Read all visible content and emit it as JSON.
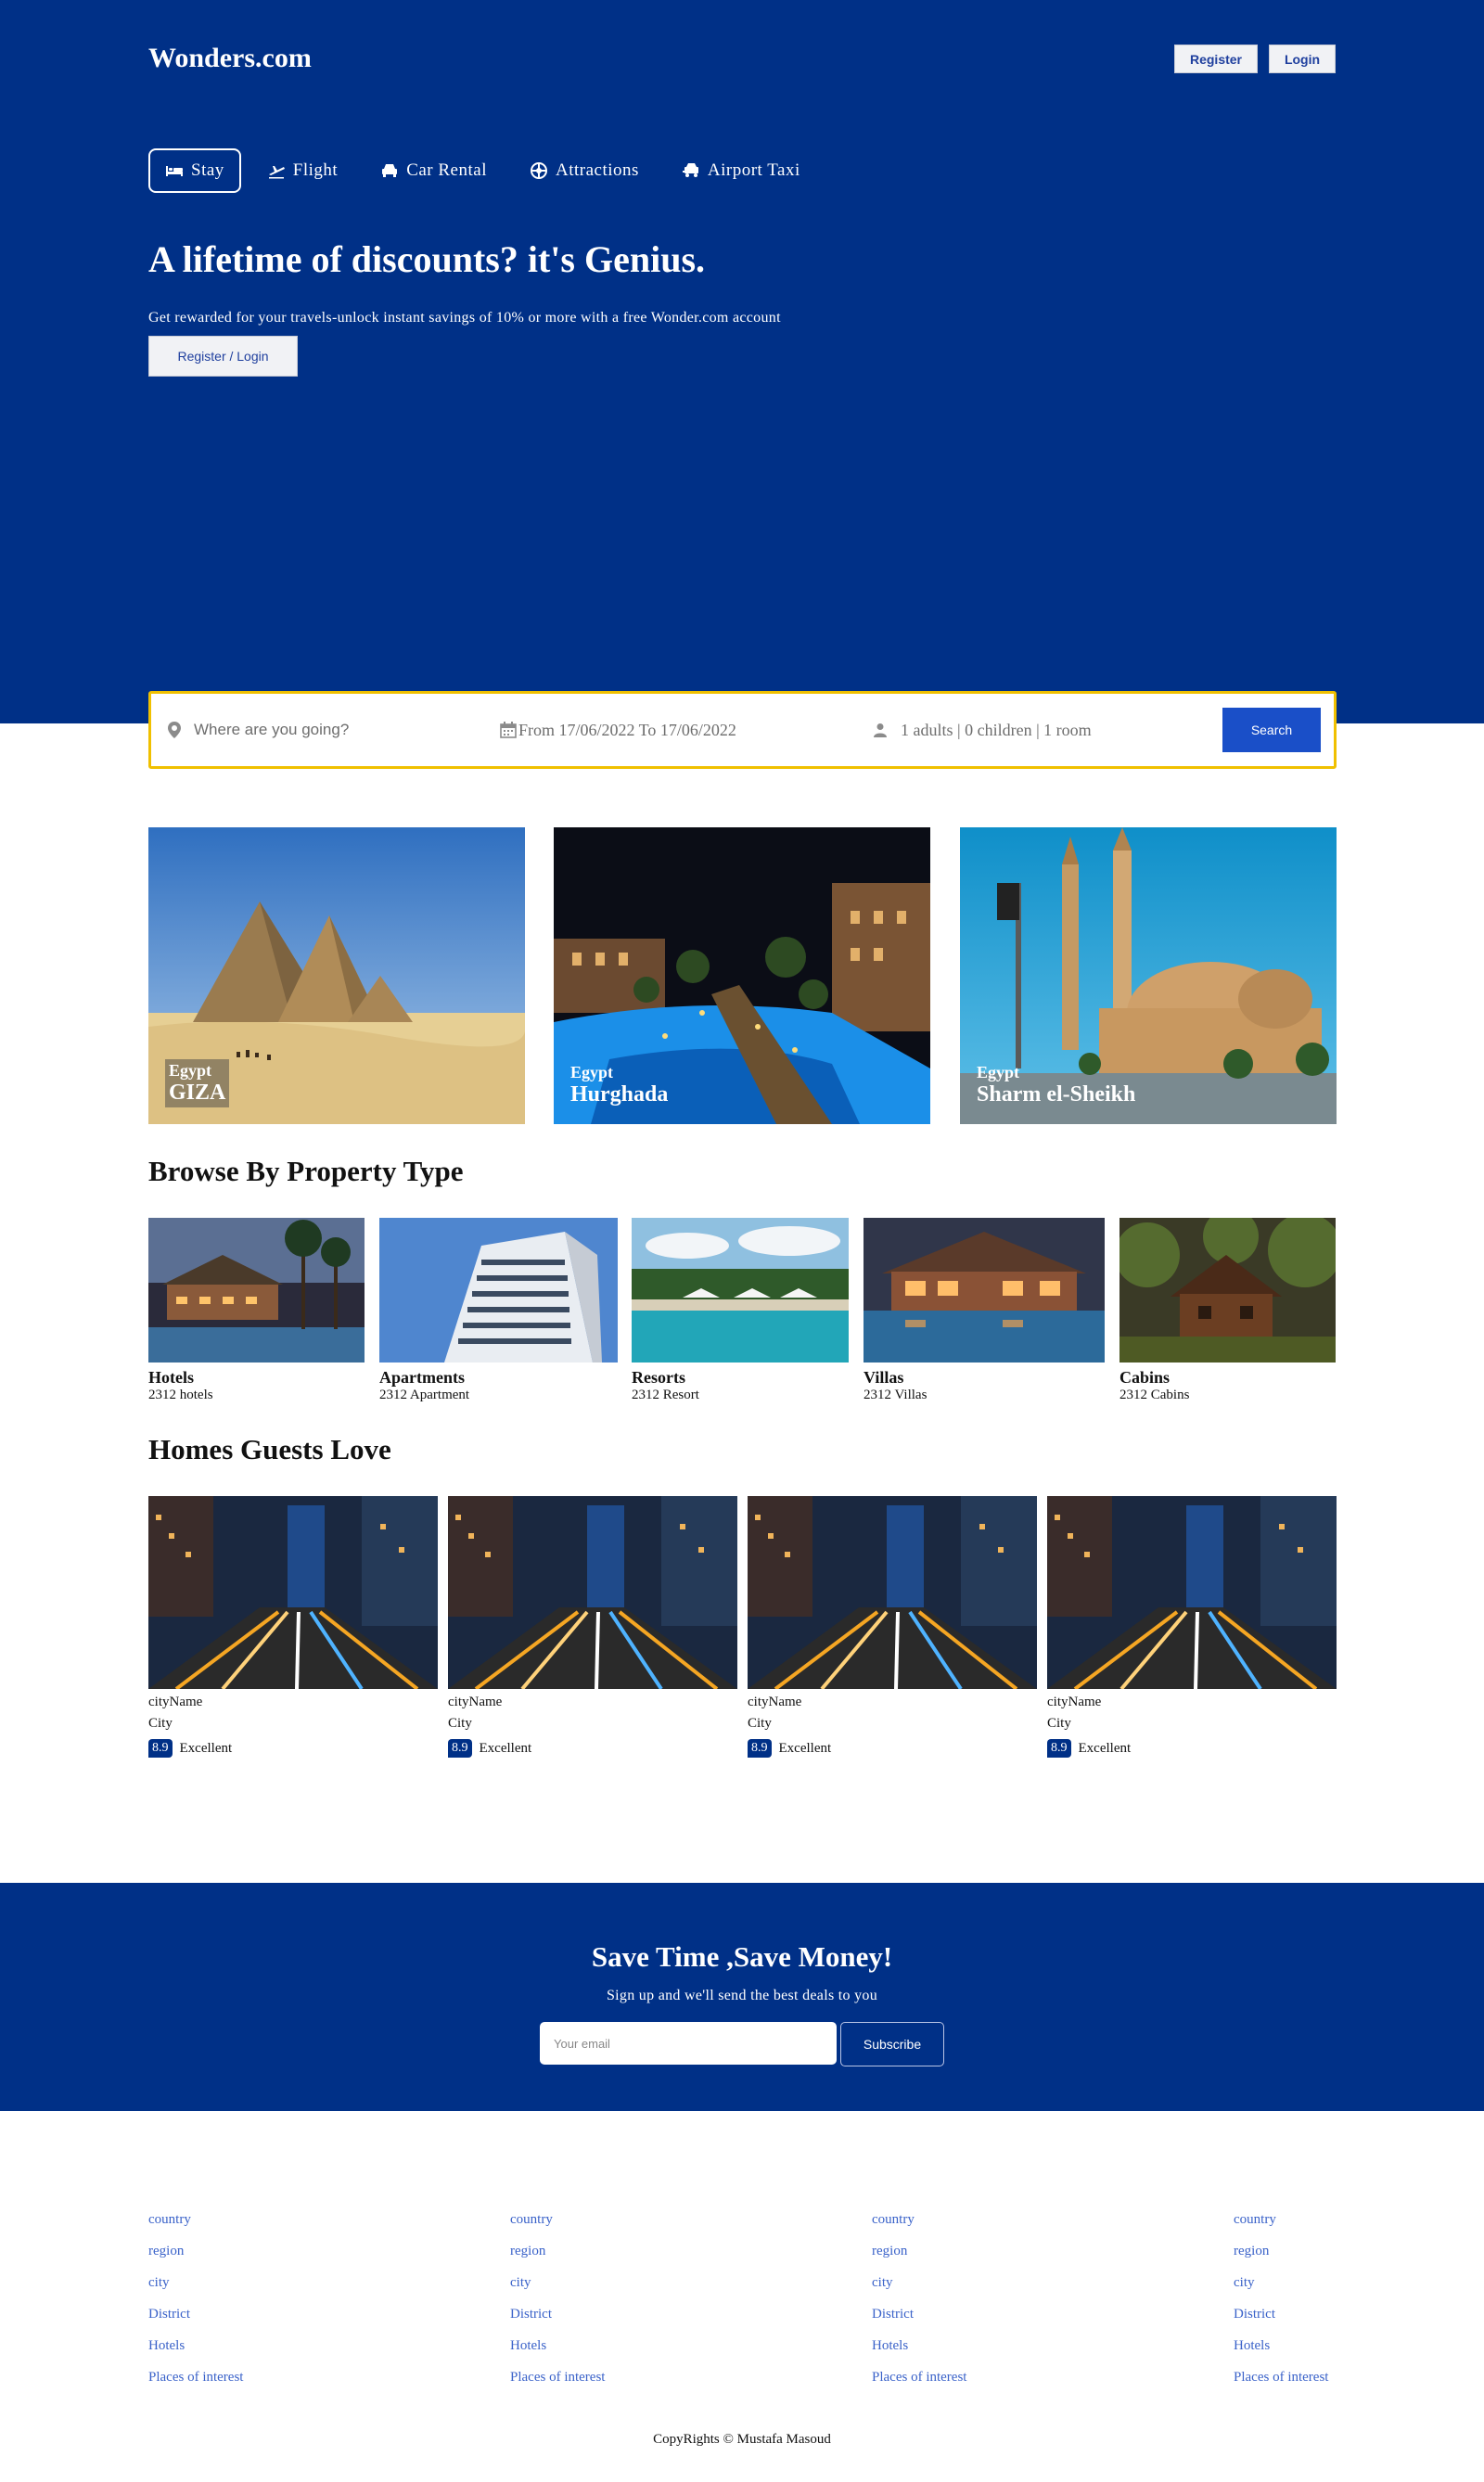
{
  "header": {
    "logo": "Wonders.com",
    "register": "Register",
    "login": "Login"
  },
  "nav": [
    {
      "label": "Stay",
      "icon": "bed-icon",
      "active": true
    },
    {
      "label": "Flight",
      "icon": "plane-icon"
    },
    {
      "label": "Car Rental",
      "icon": "car-icon"
    },
    {
      "label": "Attractions",
      "icon": "attractions-icon"
    },
    {
      "label": "Airport Taxi",
      "icon": "taxi-icon"
    }
  ],
  "hero": {
    "title": "A lifetime of discounts? it's Genius.",
    "subtitle": "Get rewarded for your travels-unlock instant savings of 10% or more with a free Wonder.com account",
    "cta": "Register / Login"
  },
  "search": {
    "destination_placeholder": "Where are you going?",
    "dates": "From 17/06/2022 To 17/06/2022",
    "options": "1 adults | 0 children | 1 room",
    "button": "Search"
  },
  "featured": [
    {
      "country": "Egypt",
      "city": "GIZA"
    },
    {
      "country": "Egypt",
      "city": "Hurghada"
    },
    {
      "country": "Egypt",
      "city": "Sharm el-Sheikh"
    }
  ],
  "property_section": {
    "title": "Browse By Property Type",
    "items": [
      {
        "name": "Hotels",
        "count": "2312 hotels"
      },
      {
        "name": "Apartments",
        "count": "2312 Apartment"
      },
      {
        "name": "Resorts",
        "count": "2312 Resort"
      },
      {
        "name": "Villas",
        "count": "2312 Villas"
      },
      {
        "name": "Cabins",
        "count": "2312 Cabins"
      }
    ]
  },
  "homes_section": {
    "title": "Homes Guests Love",
    "items": [
      {
        "name": "cityName",
        "city": "City",
        "rating": "8.9",
        "rating_text": "Excellent"
      },
      {
        "name": "cityName",
        "city": "City",
        "rating": "8.9",
        "rating_text": "Excellent"
      },
      {
        "name": "cityName",
        "city": "City",
        "rating": "8.9",
        "rating_text": "Excellent"
      },
      {
        "name": "cityName",
        "city": "City",
        "rating": "8.9",
        "rating_text": "Excellent"
      }
    ]
  },
  "newsletter": {
    "title": "Save Time ,Save Money!",
    "subtitle": "Sign up and we'll send the best deals to you",
    "email_placeholder": "Your email",
    "button": "Subscribe"
  },
  "footer": {
    "columns": [
      [
        "country",
        "region",
        "city",
        "District",
        "Hotels",
        "Places of interest"
      ],
      [
        "country",
        "region",
        "city",
        "District",
        "Hotels",
        "Places of interest"
      ],
      [
        "country",
        "region",
        "city",
        "District",
        "Hotels",
        "Places of interest"
      ],
      [
        "country",
        "region",
        "city",
        "District",
        "Hotels",
        "Places of interest"
      ]
    ],
    "copyright": "CopyRights © Mustafa Masoud"
  },
  "colors": {
    "brand_blue": "#003087",
    "search_button": "#1a4fc8",
    "search_border": "#f0c000",
    "link": "#3a62c9"
  }
}
